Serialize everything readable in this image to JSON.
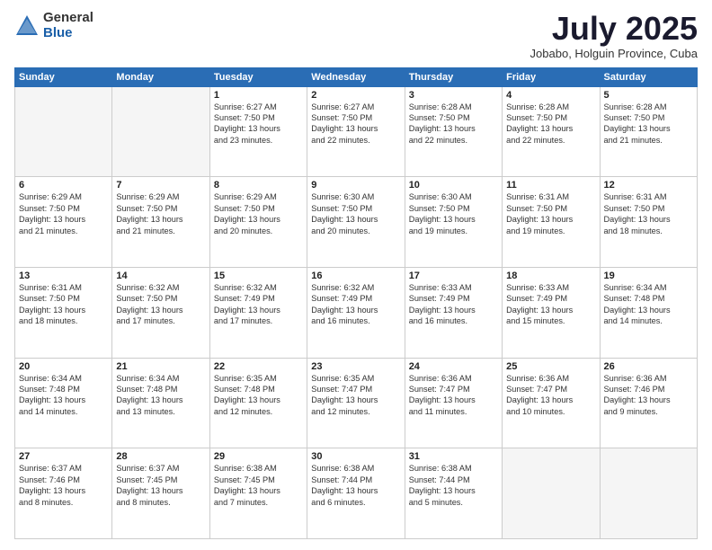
{
  "header": {
    "logo_general": "General",
    "logo_blue": "Blue",
    "month_title": "July 2025",
    "subtitle": "Jobabo, Holguin Province, Cuba"
  },
  "weekdays": [
    "Sunday",
    "Monday",
    "Tuesday",
    "Wednesday",
    "Thursday",
    "Friday",
    "Saturday"
  ],
  "weeks": [
    [
      {
        "day": "",
        "info": ""
      },
      {
        "day": "",
        "info": ""
      },
      {
        "day": "1",
        "info": "Sunrise: 6:27 AM\nSunset: 7:50 PM\nDaylight: 13 hours\nand 23 minutes."
      },
      {
        "day": "2",
        "info": "Sunrise: 6:27 AM\nSunset: 7:50 PM\nDaylight: 13 hours\nand 22 minutes."
      },
      {
        "day": "3",
        "info": "Sunrise: 6:28 AM\nSunset: 7:50 PM\nDaylight: 13 hours\nand 22 minutes."
      },
      {
        "day": "4",
        "info": "Sunrise: 6:28 AM\nSunset: 7:50 PM\nDaylight: 13 hours\nand 22 minutes."
      },
      {
        "day": "5",
        "info": "Sunrise: 6:28 AM\nSunset: 7:50 PM\nDaylight: 13 hours\nand 21 minutes."
      }
    ],
    [
      {
        "day": "6",
        "info": "Sunrise: 6:29 AM\nSunset: 7:50 PM\nDaylight: 13 hours\nand 21 minutes."
      },
      {
        "day": "7",
        "info": "Sunrise: 6:29 AM\nSunset: 7:50 PM\nDaylight: 13 hours\nand 21 minutes."
      },
      {
        "day": "8",
        "info": "Sunrise: 6:29 AM\nSunset: 7:50 PM\nDaylight: 13 hours\nand 20 minutes."
      },
      {
        "day": "9",
        "info": "Sunrise: 6:30 AM\nSunset: 7:50 PM\nDaylight: 13 hours\nand 20 minutes."
      },
      {
        "day": "10",
        "info": "Sunrise: 6:30 AM\nSunset: 7:50 PM\nDaylight: 13 hours\nand 19 minutes."
      },
      {
        "day": "11",
        "info": "Sunrise: 6:31 AM\nSunset: 7:50 PM\nDaylight: 13 hours\nand 19 minutes."
      },
      {
        "day": "12",
        "info": "Sunrise: 6:31 AM\nSunset: 7:50 PM\nDaylight: 13 hours\nand 18 minutes."
      }
    ],
    [
      {
        "day": "13",
        "info": "Sunrise: 6:31 AM\nSunset: 7:50 PM\nDaylight: 13 hours\nand 18 minutes."
      },
      {
        "day": "14",
        "info": "Sunrise: 6:32 AM\nSunset: 7:50 PM\nDaylight: 13 hours\nand 17 minutes."
      },
      {
        "day": "15",
        "info": "Sunrise: 6:32 AM\nSunset: 7:49 PM\nDaylight: 13 hours\nand 17 minutes."
      },
      {
        "day": "16",
        "info": "Sunrise: 6:32 AM\nSunset: 7:49 PM\nDaylight: 13 hours\nand 16 minutes."
      },
      {
        "day": "17",
        "info": "Sunrise: 6:33 AM\nSunset: 7:49 PM\nDaylight: 13 hours\nand 16 minutes."
      },
      {
        "day": "18",
        "info": "Sunrise: 6:33 AM\nSunset: 7:49 PM\nDaylight: 13 hours\nand 15 minutes."
      },
      {
        "day": "19",
        "info": "Sunrise: 6:34 AM\nSunset: 7:48 PM\nDaylight: 13 hours\nand 14 minutes."
      }
    ],
    [
      {
        "day": "20",
        "info": "Sunrise: 6:34 AM\nSunset: 7:48 PM\nDaylight: 13 hours\nand 14 minutes."
      },
      {
        "day": "21",
        "info": "Sunrise: 6:34 AM\nSunset: 7:48 PM\nDaylight: 13 hours\nand 13 minutes."
      },
      {
        "day": "22",
        "info": "Sunrise: 6:35 AM\nSunset: 7:48 PM\nDaylight: 13 hours\nand 12 minutes."
      },
      {
        "day": "23",
        "info": "Sunrise: 6:35 AM\nSunset: 7:47 PM\nDaylight: 13 hours\nand 12 minutes."
      },
      {
        "day": "24",
        "info": "Sunrise: 6:36 AM\nSunset: 7:47 PM\nDaylight: 13 hours\nand 11 minutes."
      },
      {
        "day": "25",
        "info": "Sunrise: 6:36 AM\nSunset: 7:47 PM\nDaylight: 13 hours\nand 10 minutes."
      },
      {
        "day": "26",
        "info": "Sunrise: 6:36 AM\nSunset: 7:46 PM\nDaylight: 13 hours\nand 9 minutes."
      }
    ],
    [
      {
        "day": "27",
        "info": "Sunrise: 6:37 AM\nSunset: 7:46 PM\nDaylight: 13 hours\nand 8 minutes."
      },
      {
        "day": "28",
        "info": "Sunrise: 6:37 AM\nSunset: 7:45 PM\nDaylight: 13 hours\nand 8 minutes."
      },
      {
        "day": "29",
        "info": "Sunrise: 6:38 AM\nSunset: 7:45 PM\nDaylight: 13 hours\nand 7 minutes."
      },
      {
        "day": "30",
        "info": "Sunrise: 6:38 AM\nSunset: 7:44 PM\nDaylight: 13 hours\nand 6 minutes."
      },
      {
        "day": "31",
        "info": "Sunrise: 6:38 AM\nSunset: 7:44 PM\nDaylight: 13 hours\nand 5 minutes."
      },
      {
        "day": "",
        "info": ""
      },
      {
        "day": "",
        "info": ""
      }
    ]
  ]
}
